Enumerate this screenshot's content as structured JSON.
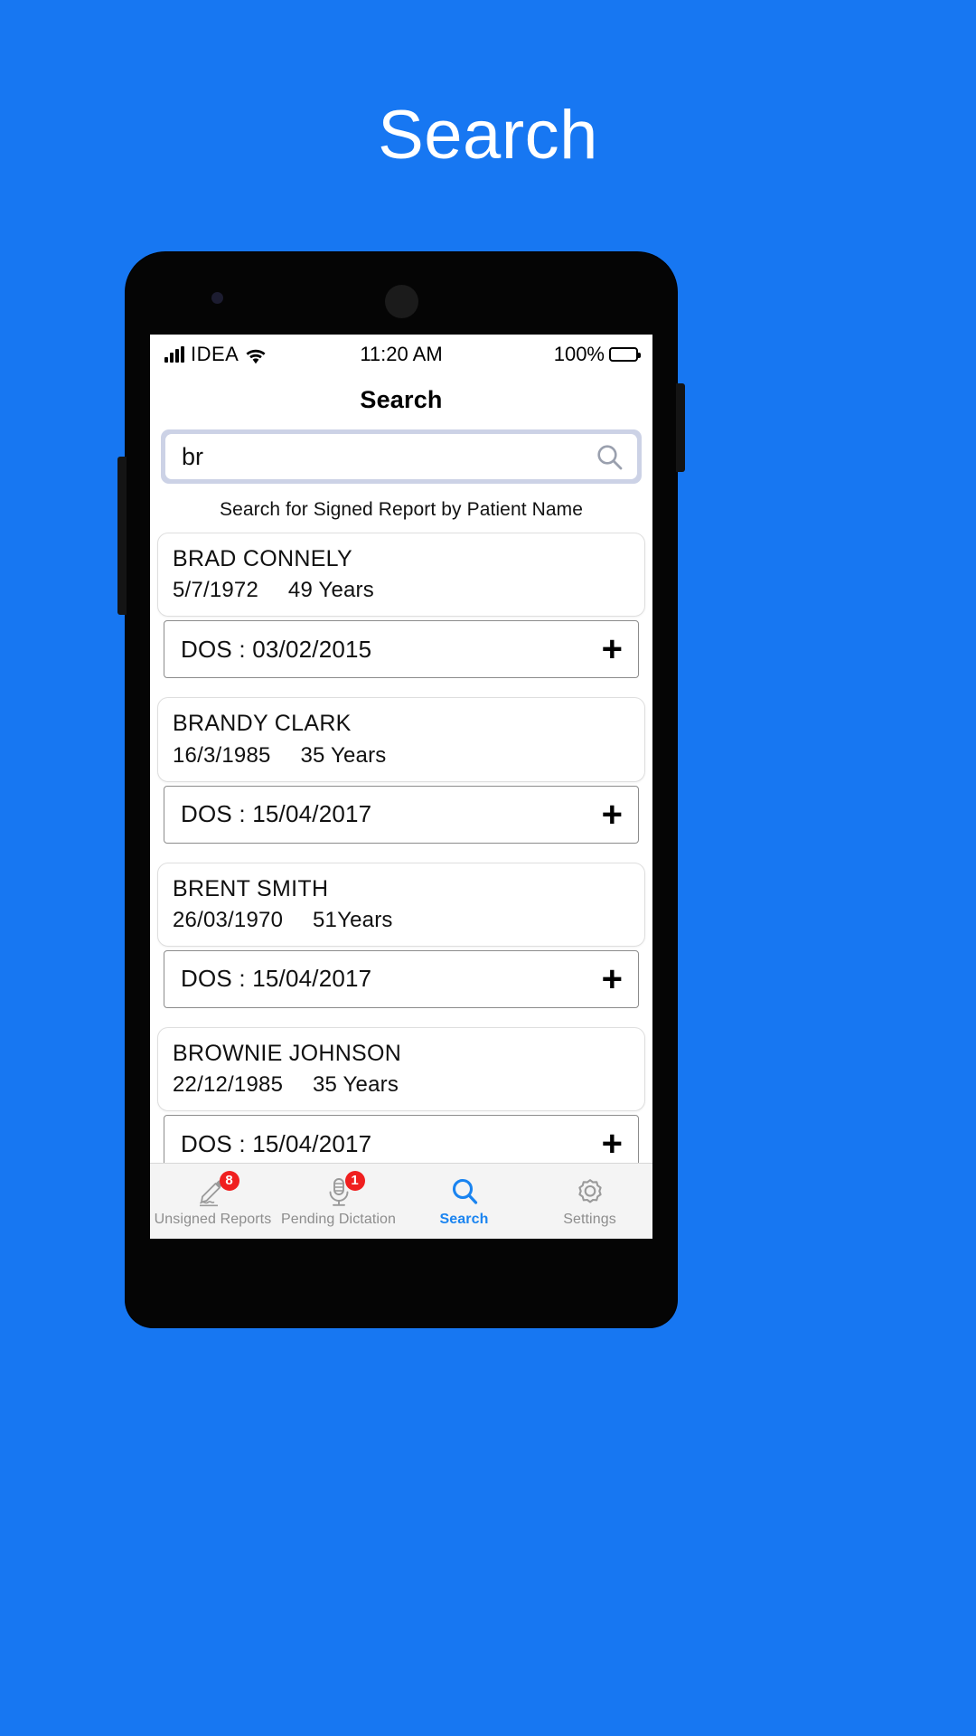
{
  "page": {
    "title": "Search",
    "background_color": "#1777f2"
  },
  "statusbar": {
    "carrier": "IDEA",
    "signal_icon": "cellular-signal-icon",
    "wifi_icon": "wifi-icon",
    "time": "11:20 AM",
    "battery_percent": "100%",
    "battery_icon": "battery-full-icon"
  },
  "navbar": {
    "title": "Search"
  },
  "search": {
    "value": "br",
    "placeholder": "Search",
    "icon": "search-icon",
    "hint": "Search for Signed Report by Patient Name"
  },
  "results": [
    {
      "name": "BRAD CONNELY",
      "dob": "5/7/1972",
      "age": "49 Years",
      "dos_label": "DOS : 03/02/2015",
      "expand_icon": "plus-icon"
    },
    {
      "name": "BRANDY CLARK",
      "dob": "16/3/1985",
      "age": "35 Years",
      "dos_label": "DOS : 15/04/2017",
      "expand_icon": "plus-icon"
    },
    {
      "name": "BRENT SMITH",
      "dob": "26/03/1970",
      "age": "51Years",
      "dos_label": "DOS : 15/04/2017",
      "expand_icon": "plus-icon"
    },
    {
      "name": "BROWNIE JOHNSON",
      "dob": "22/12/1985",
      "age": "35 Years",
      "dos_label": "DOS : 15/04/2017",
      "expand_icon": "plus-icon"
    }
  ],
  "tabbar": {
    "active_color": "#1a84f0",
    "inactive_color": "#8d8d8d",
    "badge_color": "#f01f1f",
    "items": [
      {
        "label": "Unsigned Reports",
        "icon": "signature-pen-icon",
        "badge": "8",
        "active": false
      },
      {
        "label": "Pending Dictation",
        "icon": "microphone-icon",
        "badge": "1",
        "active": false
      },
      {
        "label": "Search",
        "icon": "search-icon",
        "badge": "",
        "active": true
      },
      {
        "label": "Settings",
        "icon": "gear-icon",
        "badge": "",
        "active": false
      }
    ]
  }
}
